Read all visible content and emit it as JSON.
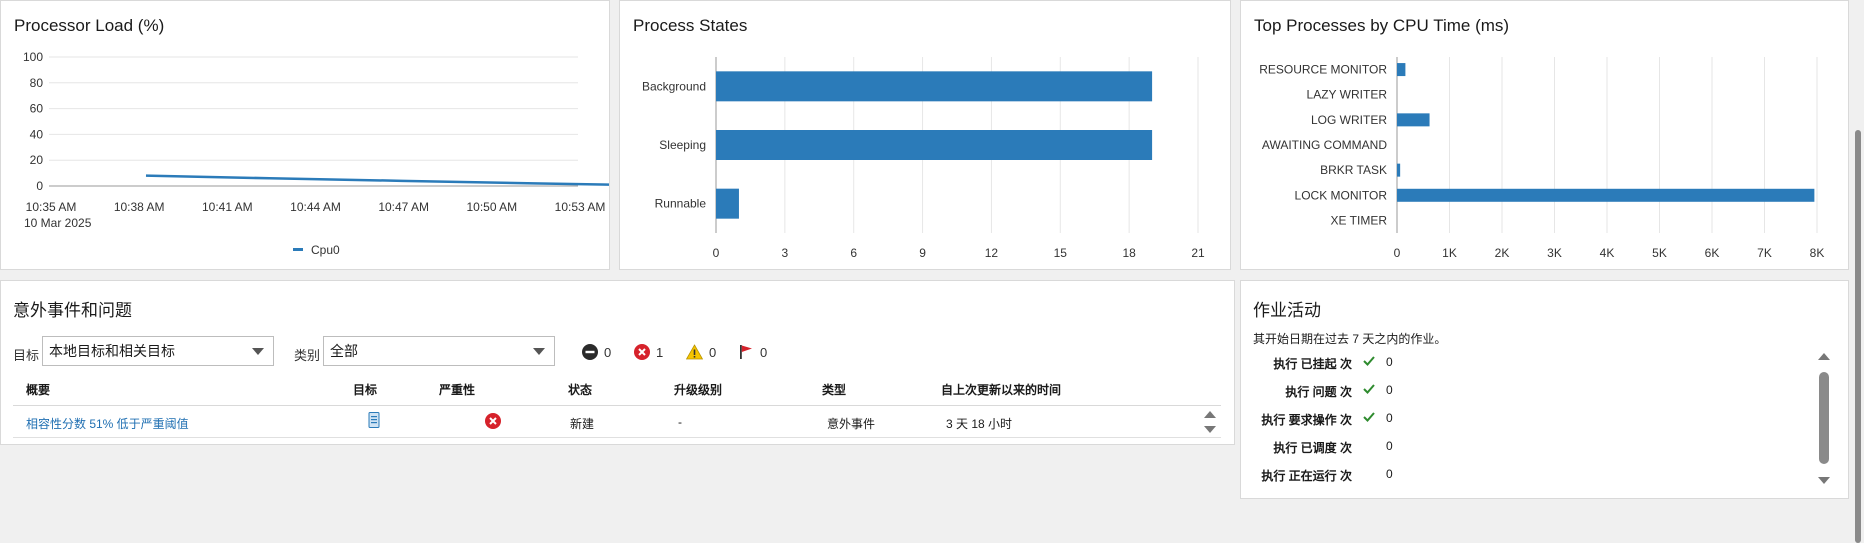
{
  "processor_load": {
    "title": "Processor Load (%)",
    "chart_data": {
      "type": "line",
      "title": "Processor Load (%)",
      "x": [
        "10:35 AM",
        "10:38 AM",
        "10:41 AM",
        "10:44 AM",
        "10:47 AM",
        "10:50 AM",
        "10:53 AM"
      ],
      "x_sub": "10 Mar 2025",
      "ylim": [
        0,
        100
      ],
      "yticks": [
        0,
        20,
        40,
        60,
        80,
        100
      ],
      "series": [
        {
          "name": "Cpu0",
          "color": "#2b7bb9",
          "points": [
            [
              1.1,
              8
            ],
            [
              2.5,
              6
            ],
            [
              4.0,
              4
            ],
            [
              5.5,
              2
            ],
            [
              6.4,
              1
            ]
          ]
        }
      ],
      "legend_position": "bottom",
      "grid": true
    }
  },
  "process_states": {
    "title": "Process States",
    "chart_data": {
      "type": "bar",
      "orientation": "horizontal",
      "title": "Process States",
      "categories": [
        "Background",
        "Sleeping",
        "Runnable"
      ],
      "values": [
        19,
        19,
        1
      ],
      "xlim": [
        0,
        21
      ],
      "xticks": [
        0,
        3,
        6,
        9,
        12,
        15,
        18,
        21
      ],
      "color": "#2b7bb9",
      "grid": true
    }
  },
  "top_processes": {
    "title": "Top Processes by CPU Time (ms)",
    "chart_data": {
      "type": "bar",
      "orientation": "horizontal",
      "title": "Top Processes by CPU Time (ms)",
      "categories": [
        "RESOURCE MONITOR",
        "LAZY WRITER",
        "LOG WRITER",
        "AWAITING COMMAND",
        "BRKR TASK",
        "LOCK MONITOR",
        "XE TIMER"
      ],
      "values": [
        160,
        0,
        620,
        0,
        60,
        7950,
        0
      ],
      "xlim": [
        0,
        8000
      ],
      "xticks": [
        0,
        1000,
        2000,
        3000,
        4000,
        5000,
        6000,
        7000,
        8000
      ],
      "xtick_labels": [
        "0",
        "1K",
        "2K",
        "3K",
        "4K",
        "5K",
        "6K",
        "7K",
        "8K"
      ],
      "color": "#2b7bb9",
      "grid": true
    }
  },
  "incidents": {
    "title": "意外事件和问题",
    "target_label": "目标",
    "target_value": "本地目标和相关目标",
    "category_label": "类别",
    "category_value": "全部",
    "counters": {
      "blocked": "0",
      "critical": "1",
      "warning": "0",
      "flag": "0"
    },
    "columns": [
      "概要",
      "目标",
      "严重性",
      "状态",
      "升级级别",
      "类型",
      "自上次更新以来的时间"
    ],
    "rows": [
      {
        "summary": "相容性分数 51% 低于严重阈值",
        "status": "新建",
        "escalation": "-",
        "type": "意外事件",
        "time": "3 天 18 小时"
      }
    ]
  },
  "job_activity": {
    "title": "作业活动",
    "subtitle": "其开始日期在过去 7 天之内的作业。",
    "rows": [
      {
        "label": "执行 已挂起 次",
        "check": true,
        "value": "0"
      },
      {
        "label": "执行 问题 次",
        "check": true,
        "value": "0"
      },
      {
        "label": "执行 要求操作 次",
        "check": true,
        "value": "0"
      },
      {
        "label": "执行 已调度 次",
        "check": false,
        "value": "0"
      },
      {
        "label": "执行 正在运行 次",
        "check": false,
        "value": "0"
      }
    ]
  },
  "colors": {
    "bar": "#2b7bb9",
    "critical": "#d6222b",
    "warning": "#f5c400",
    "link": "#1f6fb2"
  }
}
